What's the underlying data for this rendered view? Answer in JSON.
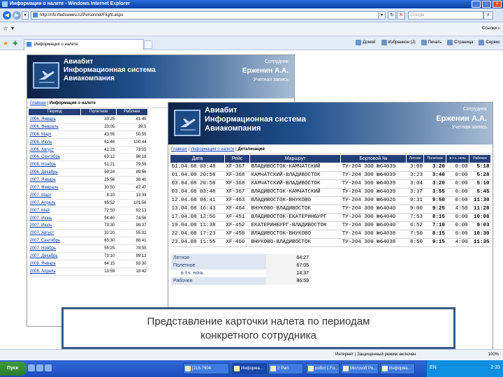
{
  "browser": {
    "title": "Информация о налете - Windows Internet Explorer",
    "url": "http://nfo:rtedsweeu.ru/Personnel/Flight.aspx",
    "search_placeholder": "Google",
    "links_label": "Ссылки »",
    "tab_title": "Информация о налете",
    "commands": [
      "Домой",
      "Избранное (J)",
      "Печать",
      "Страница",
      "Сервис"
    ]
  },
  "app": {
    "brand_line1": "Авиабит",
    "brand_line2": "Информационная система",
    "brand_line3": "Авиакомпания",
    "role_label": "Сотрудник",
    "user_name": "Ерженин А.А.",
    "account_label": "Учетная запись"
  },
  "window1": {
    "crumb_home": "Главная",
    "crumb_current": "Информация о налете",
    "columns": [
      "Период",
      "Полетное",
      "Рабочее"
    ],
    "rows": [
      [
        "2006. Январь",
        "33:25",
        "41:45"
      ],
      [
        "2006. Февраль",
        "23:05",
        "39:5"
      ],
      [
        "2006. Март",
        "43:55",
        "50:55"
      ],
      [
        "2006. Июль",
        "61:46",
        "100:44"
      ],
      [
        "2006. Август",
        "41:23",
        "73:05"
      ],
      [
        "2006. Сентябрь",
        "63:12",
        "98:18"
      ],
      [
        "2006. Ноябрь",
        "51:21",
        "79:59"
      ],
      [
        "2006. Декабрь",
        "59:24",
        "89:56"
      ],
      [
        "2007. Январь",
        "25:56",
        "38:40"
      ],
      [
        "2007. Февраль",
        "30:50",
        "47:47"
      ],
      [
        "2007. Март",
        "8:10",
        "13:34"
      ],
      [
        "2007. Апрель",
        "65:52",
        "101:56"
      ],
      [
        "2007. Май",
        "72:50",
        "92:13"
      ],
      [
        "2007. Июнь",
        "54:40",
        "74:56"
      ],
      [
        "2007. Июль",
        "73:30",
        "98:37"
      ],
      [
        "2007. Август",
        "32:20",
        "55:31"
      ],
      [
        "2007. Сентябрь",
        "65:30",
        "88:41"
      ],
      [
        "2007. Ноябрь",
        "55:25",
        "78:55"
      ],
      [
        "2007. Декабрь",
        "73:10",
        "99:12"
      ],
      [
        "2008. Январь",
        "64:15",
        "93:30"
      ],
      [
        "2008. Апрель",
        "13:59",
        "18:42"
      ]
    ]
  },
  "window2": {
    "crumb_home": "Главная",
    "crumb_middle": "Информация о налете",
    "crumb_current": "Детализация",
    "columns": [
      "Дата",
      "Рейс",
      "Маршрут",
      "Бортовой №",
      "Летное",
      "Полетное",
      "в т.ч. ночь",
      "Рабочее"
    ],
    "rows": [
      [
        "01.04.08 03:48",
        "XF-367",
        "ВЛАДИВОСТОК-КАМЧАТСКИЙ",
        "ТУ-204 300 №64039",
        "3:00",
        "3:20",
        "0:00",
        "5:18"
      ],
      [
        "01.04.08 20:58",
        "XF-368",
        "КАМЧАТСКИЙ-ВЛАДИВОСТОК",
        "ТУ-204 300 №64039",
        "3:23",
        "3:40",
        "0:00",
        "5:28"
      ],
      [
        "03.04.08 20:58",
        "XF-368",
        "КАМЧАТСКИЙ-ВЛАДИВОСТОК",
        "ТУ-204 300 №64039",
        "3:04",
        "3:20",
        "0:00",
        "5:10"
      ],
      [
        "03.04.08 03:48",
        "XF-367",
        "ВЛАДИВОСТОК-КАМЧАТСКИЙ",
        "ТУ-204 300 №64039",
        "3:37",
        "3:55",
        "0:00",
        "5:45"
      ],
      [
        "12.04.08 04:41",
        "XF-463",
        "ВЛАДИВОСТОК-ВНУКОВО",
        "ТУ-204 300 №64026",
        "9:31",
        "9:50",
        "0:00",
        "11:30"
      ],
      [
        "13.04.08 16:43",
        "XF-464",
        "ВНУКОВО-ВЛАДИВОСТОК",
        "ТУ-204 300 №64040",
        "9:00",
        "9:25",
        "4:50",
        "11:28"
      ],
      [
        "17.04.08 12:56",
        "XF-451",
        "ВЛАДИВОСТОК-ЕКАТЕРИНБУРГ",
        "ТУ-204 300 №64040",
        "7:53",
        "8:15",
        "0:00",
        "10:08"
      ],
      [
        "19.04.08 11:38",
        "XF-452",
        "ЕКАТЕРИНБУРГ-ВЛАДИВОСТОК",
        "ТУ-204 300 №64040",
        "6:52",
        "7:10",
        "0:00",
        "9:03"
      ],
      [
        "22.04.08 17:23",
        "XF-459",
        "ВЛАДИВОСТОК-ВНУКОВО",
        "ТУ-204 300 №64038",
        "7:50",
        "8:15",
        "0:00",
        "10:30"
      ],
      [
        "23.04.08 11:55",
        "XF-460",
        "ВНУКОВО-ВЛАДИВОСТОК",
        "ТУ-204 300 №64038",
        "8:50",
        "9:15",
        "4:00",
        "11:35"
      ]
    ],
    "summary": [
      {
        "label": "Летное",
        "value": "64:27"
      },
      {
        "label": "Полетное",
        "value": "67:05"
      },
      {
        "label": "в т.ч. ночь",
        "value": "14:37"
      },
      {
        "label": "Рабочее",
        "value": "86:59"
      }
    ]
  },
  "caption": {
    "line1": "Представление карточки налета по периодам",
    "line2": "конкретного сотрудника"
  },
  "taskbar": {
    "start": "Пуск",
    "buttons": [
      "[215-7904",
      "Информа...",
      "2 Part",
      "робот1.Fo...",
      "Microsoft Po...",
      "Информа..."
    ],
    "lang": "EN",
    "clock": "2:35"
  },
  "status": {
    "text": "Интернет | Защищенный режим: включен",
    "zoom": "100%"
  }
}
